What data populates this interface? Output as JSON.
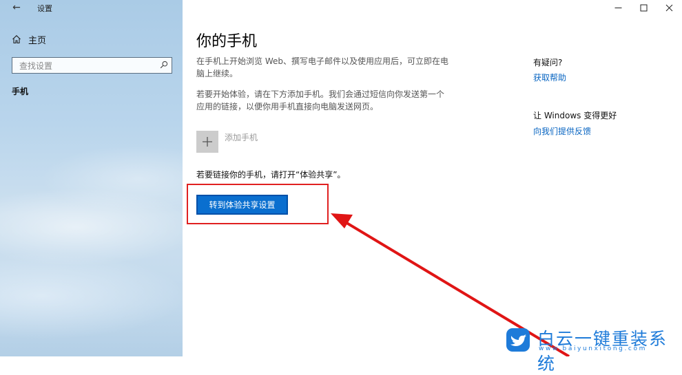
{
  "window": {
    "title": "设置",
    "back_glyph": "←",
    "controls": [
      "minimize-icon",
      "maximize-icon",
      "close-icon"
    ]
  },
  "sidebar": {
    "home_label": "主页",
    "home_icon": "home-icon",
    "search_placeholder": "查找设置",
    "search_icon": "search-icon",
    "nav_items": [
      {
        "label": "手机",
        "selected": true
      }
    ]
  },
  "main": {
    "title": "你的手机",
    "description_1": "在手机上开始浏览 Web、撰写电子邮件以及使用应用后，可立即在电脑上继续。",
    "description_2": "若要开始体验，请在下方添加手机。我们会通过短信向你发送第一个应用的链接，以便你用手机直接向电脑发送网页。",
    "add_phone_label": "添加手机",
    "add_phone_icon": "plus-icon",
    "link_hint": "若要链接你的手机，请打开“体验共享”。",
    "primary_button": "转到体验共享设置"
  },
  "aside": {
    "question_title": "有疑问?",
    "question_link": "获取帮助",
    "feedback_title": "让 Windows 变得更好",
    "feedback_link": "向我们提供反馈"
  },
  "annotation": {
    "highlight_color": "#e02020"
  },
  "watermark": {
    "text": "白云一键重装系统",
    "url": "www.baiyunxitong.com",
    "color": "#1e7bd9"
  },
  "colors": {
    "accent": "#0a6fcf",
    "link": "#0a66c2"
  }
}
